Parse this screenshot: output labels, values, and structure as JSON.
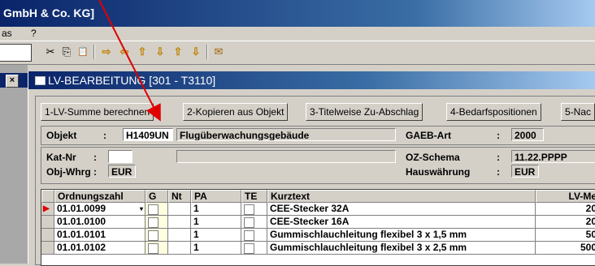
{
  "window": {
    "title": "GmbH & Co. KG]"
  },
  "menubar": {
    "items": [
      "as",
      "?"
    ]
  },
  "toolbar": {
    "icons": [
      "scissors-icon",
      "copy-icon",
      "paste-icon",
      "arrow-right-icon",
      "arrow-left-icon",
      "arrow-up-icon",
      "arrow-down-icon",
      "arrow-top-icon",
      "arrow-bottom-icon",
      "mail-icon"
    ],
    "glyphs": {
      "cut": "✂",
      "copy": "⎘",
      "paste": "📋",
      "right": "⇨",
      "left": "⇦",
      "up": "⇧",
      "down": "⇩",
      "top": "⇧",
      "bottom": "⇩",
      "mail": "✉"
    }
  },
  "child_window": {
    "title": "LV-BEARBEITUNG  [301 - T3110]"
  },
  "tabs": [
    "1-LV-Summe berechnen",
    "2-Kopieren aus Objekt",
    "3-Titelweise Zu-Abschlag",
    "4-Bedarfspositionen",
    "5-Nac"
  ],
  "header": {
    "objekt_label": "Objekt",
    "colon": ":",
    "objekt_code": "H1409UN",
    "objekt_name": "Flugüberwachungsgebäude",
    "gaeb_label": "GAEB-Art",
    "gaeb_value": "2000",
    "katnr_label": "Kat-Nr",
    "katnr_value": "",
    "objwhrg_label": "Obj-Whrg",
    "objwhrg_value": "EUR",
    "oz_label": "OZ-Schema",
    "oz_value": "11.22.PPPP",
    "hw_label": "Hauswährung",
    "hw_value": "EUR"
  },
  "grid": {
    "columns": [
      "Ordnungszahl",
      "G",
      "Nt",
      "PA",
      "TE",
      "Kurztext",
      "LV-Me"
    ],
    "rows": [
      {
        "oz": "01.01.0099",
        "pa": "1",
        "kurztext": "CEE-Stecker 32A",
        "lvme": "20"
      },
      {
        "oz": "01.01.0100",
        "pa": "1",
        "kurztext": "CEE-Stecker 16A",
        "lvme": "20"
      },
      {
        "oz": "01.01.0101",
        "pa": "1",
        "kurztext": "Gummischlauchleitung flexibel 3 x 1,5 mm",
        "lvme": "50"
      },
      {
        "oz": "01.01.0102",
        "pa": "1",
        "kurztext": "Gummischlauchleitung flexibel 3 x 2,5 mm",
        "lvme": "500"
      }
    ]
  },
  "colors": {
    "title_gradient_start": "#0a246a",
    "title_gradient_end": "#a6caf0",
    "annotation_arrow": "#e00000",
    "row_indicator": "#e00000"
  }
}
